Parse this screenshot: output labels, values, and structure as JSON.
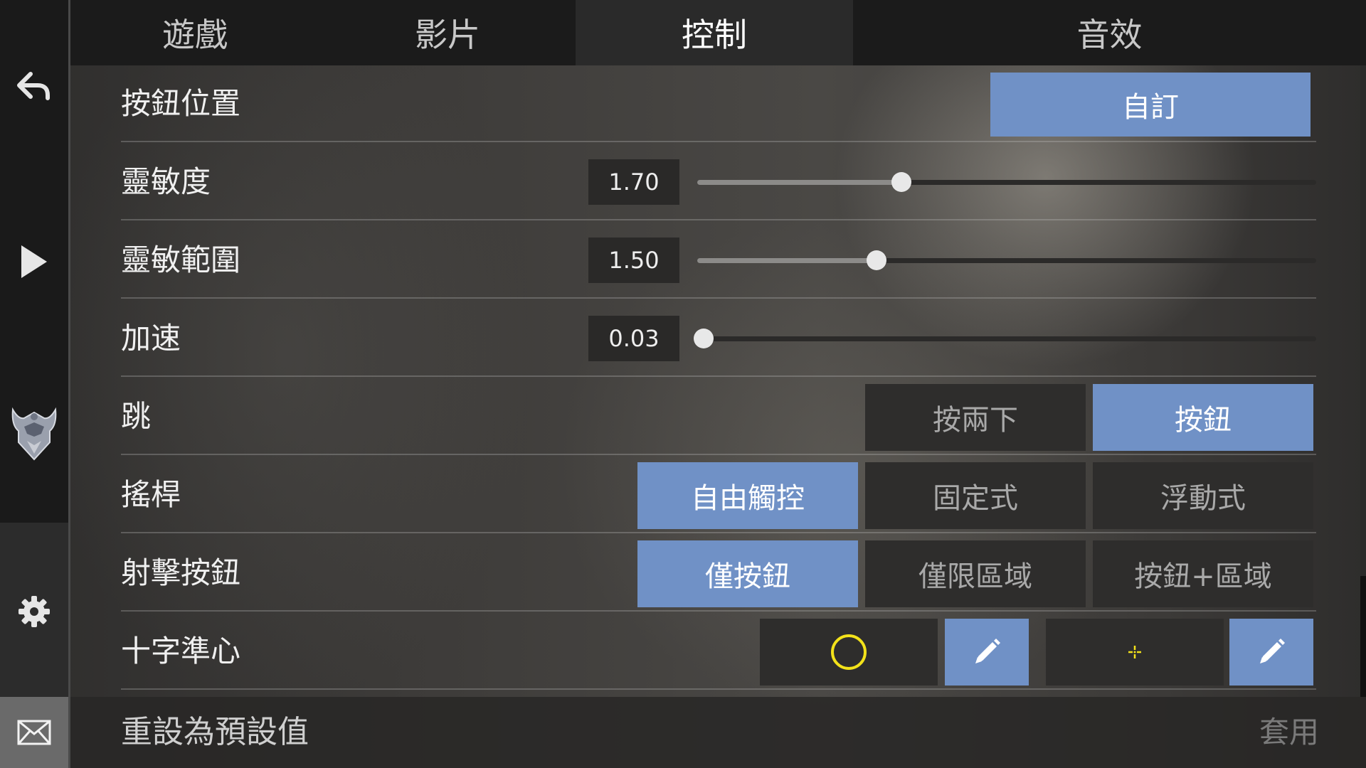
{
  "tabs": [
    {
      "label": "遊戲",
      "active": false
    },
    {
      "label": "影片",
      "active": false
    },
    {
      "label": "控制",
      "active": true
    },
    {
      "label": "音效",
      "active": false
    }
  ],
  "sidebar": {
    "icons": [
      "back-arrow-icon",
      "play-icon",
      "team-logo-icon",
      "gear-icon",
      "mail-icon"
    ]
  },
  "settings": {
    "button_position": {
      "label": "按鈕位置",
      "value": "自訂"
    },
    "sensitivity": {
      "label": "靈敏度",
      "value": "1.70",
      "fraction": 0.33
    },
    "sensitivity_range": {
      "label": "靈敏範圍",
      "value": "1.50",
      "fraction": 0.29
    },
    "acceleration": {
      "label": "加速",
      "value": "0.03",
      "fraction": 0.01
    },
    "jump": {
      "label": "跳",
      "options": [
        "按兩下",
        "按鈕"
      ],
      "selected": 1
    },
    "joystick": {
      "label": "搖桿",
      "options": [
        "自由觸控",
        "固定式",
        "浮動式"
      ],
      "selected": 0
    },
    "fire_button": {
      "label": "射擊按鈕",
      "options": [
        "僅按鈕",
        "僅限區域",
        "按鈕+區域"
      ],
      "selected": 0
    },
    "crosshair": {
      "label": "十字準心",
      "color": "#f3e21a"
    }
  },
  "footer": {
    "reset_label": "重設為預設值",
    "apply_label": "套用"
  },
  "colors": {
    "accent": "#7091c6",
    "crosshair": "#f3e21a"
  }
}
